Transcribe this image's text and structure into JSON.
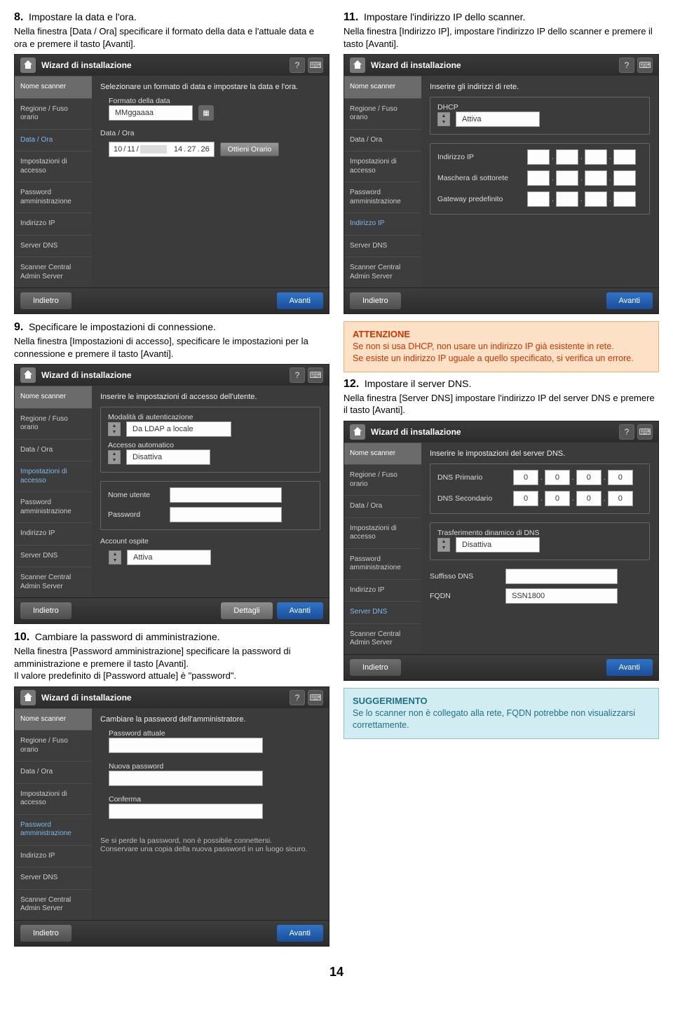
{
  "page_number": "14",
  "common": {
    "wizard_title": "Wizard di installazione",
    "btn_back": "Indietro",
    "btn_next": "Avanti",
    "btn_details": "Dettagli",
    "sidebar": {
      "nome_scanner": "Nome scanner",
      "regione": "Regione / Fuso orario",
      "data_ora": "Data / Ora",
      "imp_accesso": "Impostazioni di accesso",
      "password": "Password amministrazione",
      "indirizzo_ip": "Indirizzo IP",
      "server_dns": "Server DNS",
      "scanner_central": "Scanner Central Admin Server"
    }
  },
  "step8": {
    "num": "8.",
    "title": "Impostare la data e l'ora.",
    "desc": "Nella finestra [Data / Ora] specificare il formato della data e l'attuale data e ora e premere il tasto [Avanti].",
    "instr": "Selezionare un formato di data e impostare la data e l'ora.",
    "label_formato": "Formato della data",
    "formato_val": "MMggaaaa",
    "label_dataora": "Data / Ora",
    "date_p1": "10",
    "date_p2": "11",
    "date_t1": "14",
    "date_t2": "27",
    "date_t3": "26",
    "btn_ottieni": "Ottieni Orario"
  },
  "step9": {
    "num": "9.",
    "title": "Specificare le impostazioni di connessione.",
    "desc": "Nella finestra [Impostazioni di accesso], specificare le impostazioni per la connessione e premere il tasto [Avanti].",
    "instr": "Inserire le impostazioni di accesso dell'utente.",
    "label_modalita": "Modalità di autenticazione",
    "modalita_val": "Da LDAP a locale",
    "label_auto": "Accesso automatico",
    "auto_val": "Disattiva",
    "label_user": "Nome utente",
    "label_pwd": "Password",
    "label_ospite": "Account ospite",
    "ospite_val": "Attiva"
  },
  "step10": {
    "num": "10.",
    "title": "Cambiare la password di amministrazione.",
    "desc": "Nella finestra [Password amministrazione] specificare la password di amministrazione e premere il tasto [Avanti].\nIl valore predefinito di [Password attuale] è \"password\".",
    "instr": "Cambiare la password dell'amministratore.",
    "label_attuale": "Password attuale",
    "label_nuova": "Nuova password",
    "label_conferma": "Conferma",
    "warn1": "Se si perde la password, non è possibile connettersi.",
    "warn2": "Conservare una copia della nuova password in un luogo sicuro."
  },
  "step11": {
    "num": "11.",
    "title": "Impostare l'indirizzo IP dello scanner.",
    "desc": "Nella finestra [Indirizzo IP], impostare l'indirizzo IP dello scanner e premere il tasto [Avanti].",
    "instr": "Inserire gli indirizzi di rete.",
    "label_dhcp": "DHCP",
    "dhcp_val": "Attiva",
    "label_ip": "Indirizzo IP",
    "label_mask": "Maschera di sottorete",
    "label_gw": "Gateway predefinito"
  },
  "alert": {
    "title": "ATTENZIONE",
    "body": "Se non si usa DHCP, non usare un indirizzo IP già esistente in rete.\nSe esiste un indirizzo IP uguale a quello specificato, si verifica un errore."
  },
  "step12": {
    "num": "12.",
    "title": "Impostare il server DNS.",
    "desc": "Nella finestra [Server DNS] impostare l'indirizzo IP del server DNS e premere il tasto [Avanti].",
    "instr": "Inserire le impostazioni del server DNS.",
    "label_primario": "DNS Primario",
    "label_secondario": "DNS Secondario",
    "zero": "0",
    "label_dyn": "Trasferimento dinamico di DNS",
    "dyn_val": "Disattiva",
    "label_suffix": "Suffisso DNS",
    "label_fqdn": "FQDN",
    "fqdn_val": "SSN1800"
  },
  "hint": {
    "title": "SUGGERIMENTO",
    "body": "Se lo scanner non è collegato alla rete, FQDN potrebbe non visualizzarsi correttamente."
  }
}
